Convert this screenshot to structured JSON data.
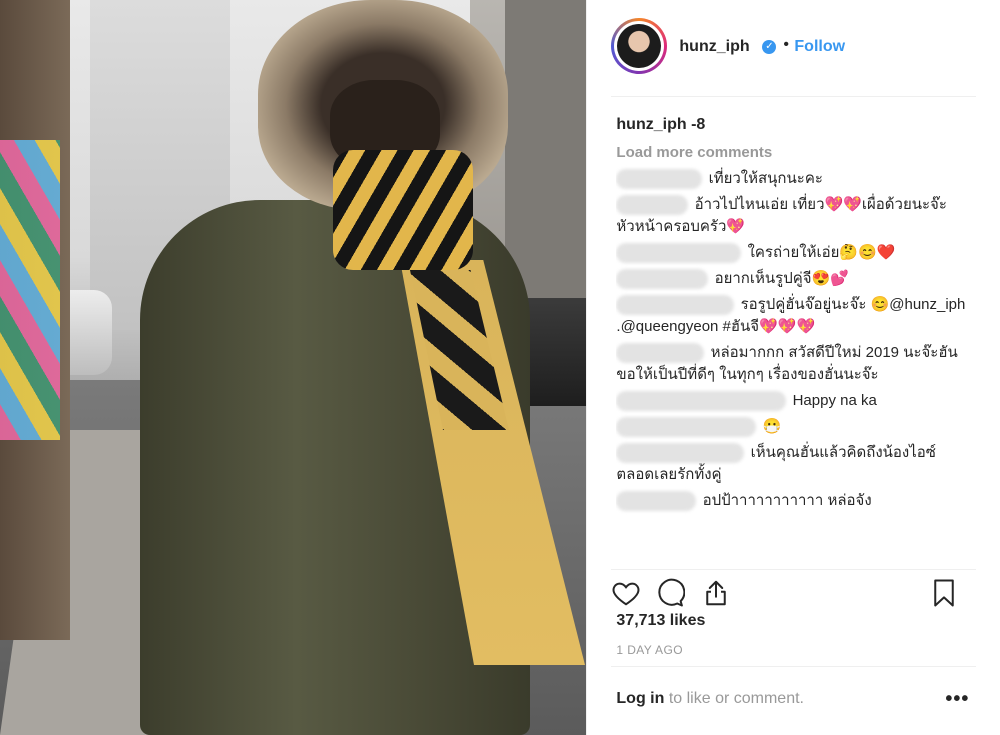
{
  "post": {
    "username": "hunz_iph",
    "follow_label": "Follow",
    "separator_dot": "•",
    "caption_user": "hunz_iph",
    "caption_text": "-8",
    "load_more": "Load more comments",
    "comments": [
      {
        "text": "เที่ยวให้สนุกนะคะ"
      },
      {
        "text": "อ้าวไปไหนเอ่ย เที่ยว💖💖เผื่อด้วยนะจ๊ะหัวหน้าครอบครัว💖"
      },
      {
        "text": "ใครถ่ายให้เอ่ย🤔😊❤️"
      },
      {
        "text": "อยากเห็นรูปคู่จี😍💕"
      },
      {
        "text": "รอรูปคู่ฮั่นจ๊อยู่นะจ๊ะ 😊@hunz_iph .@queengyeon #ฮันจี💖💖💖"
      },
      {
        "text": "หล่อมากกก สวัสดีปีใหม่ 2019 นะจ๊ะฮัน ขอให้เป็นปีที่ดีๆ ในทุกๆ เรื่องของฮั่นนะจ๊ะ"
      },
      {
        "text": "Happy na ka"
      },
      {
        "text": "😷"
      },
      {
        "text": "เห็นคุณฮั่นแล้วคิดถึงน้องไอซ์ตลอดเลยรักทั้งคู่"
      },
      {
        "text": "อปป้าาาาาาาาาาา หล่อจัง"
      }
    ],
    "likes": "37,713 likes",
    "date": "1 DAY AGO",
    "login_link": "Log in",
    "login_rest": " to like or comment.",
    "more_options": "•••"
  },
  "icons": [
    "heart-icon",
    "comment-icon",
    "share-icon",
    "bookmark-icon",
    "verified-badge-icon"
  ],
  "colors": {
    "link_blue": "#3897f0",
    "text": "#262626",
    "muted": "#999999"
  }
}
